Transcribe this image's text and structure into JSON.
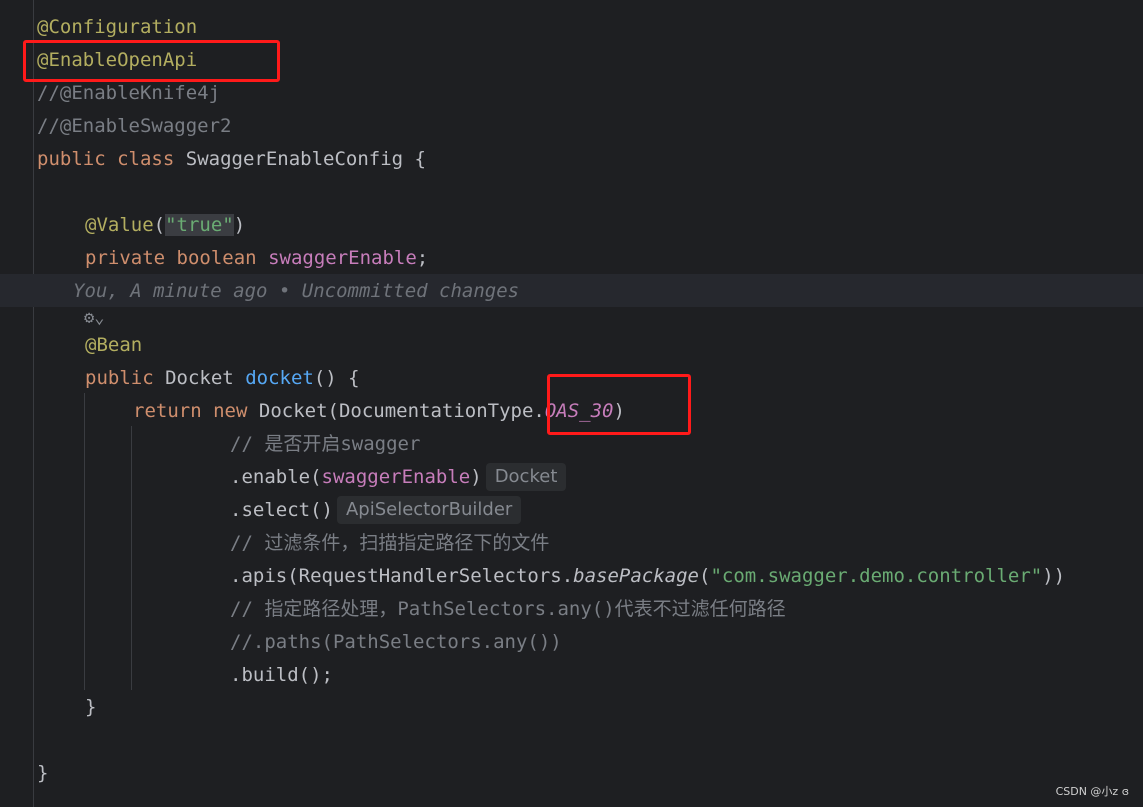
{
  "code": {
    "l1_annotation": "@Configuration",
    "l2_annotation": "@EnableOpenApi",
    "l3_comment": "//@EnableKnife4j",
    "l4_comment": "//@EnableSwagger2",
    "l5_kw_public": "public",
    "l5_kw_class": "class",
    "l5_classname": "SwaggerEnableConfig",
    "l5_brace": "{",
    "l7_annotation": "@Value",
    "l7_open": "(",
    "l7_string": "\"true\"",
    "l7_close": ")",
    "l8_kw_private": "private",
    "l8_kw_boolean": "boolean",
    "l8_field": "swaggerEnable",
    "l8_semi": ";",
    "blame": "You, A minute ago • Uncommitted changes",
    "gear_glyph": "⚙⌄",
    "l10_annotation": "@Bean",
    "l11_kw_public": "public",
    "l11_type": "Docket",
    "l11_method": "docket",
    "l11_rest": "() {",
    "l12_kw_return": "return",
    "l12_kw_new": "new",
    "l12_call": "Docket(DocumentationType.",
    "l12_const": "OAS_30",
    "l12_close": ")",
    "l13_comment": "// 是否开启swagger",
    "l14_call": ".enable(",
    "l14_field": "swaggerEnable",
    "l14_close": ")",
    "l14_hint": "Docket",
    "l15_call": ".select()",
    "l15_hint": "ApiSelectorBuilder",
    "l16_comment": "// 过滤条件，扫描指定路径下的文件",
    "l17_call": ".apis(RequestHandlerSelectors.",
    "l17_static": "basePackage",
    "l17_open": "(",
    "l17_string": "\"com.swagger.demo.controller\"",
    "l17_close": "))",
    "l18_comment": "// 指定路径处理，PathSelectors.any()代表不过滤任何路径",
    "l19_comment": "//.paths(PathSelectors.any())",
    "l20_call": ".build();",
    "l21_brace": "}",
    "l23_brace": "}"
  },
  "watermark": "CSDN @小z ɞ",
  "colors": {
    "background": "#1e1f22",
    "annotation": "#b3ae60",
    "keyword": "#cf8e6d",
    "string": "#6aab73",
    "comment": "#7a7e85",
    "field": "#c77dbb",
    "method": "#56a8f5",
    "highlight_box": "#ff1a1a"
  }
}
